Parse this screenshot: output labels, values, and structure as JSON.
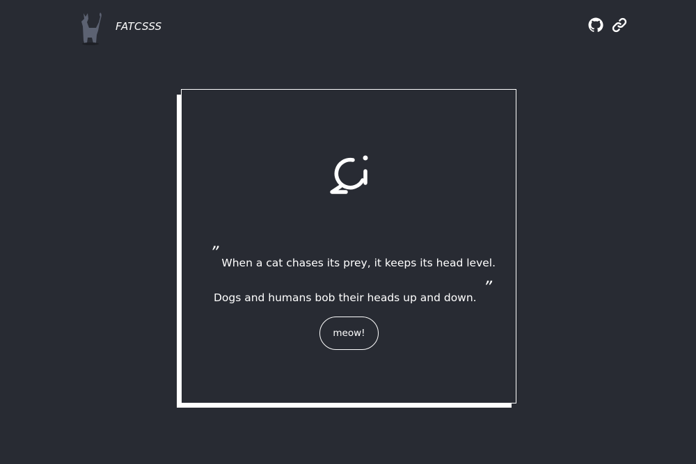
{
  "header": {
    "brand": "FATCSSS",
    "icons": [
      "cat-logo-icon",
      "github-icon",
      "link-icon"
    ]
  },
  "card": {
    "icon": "chat-info-icon",
    "quote_open": "”",
    "quote_text": "When a cat chases its prey, it keeps its head level. Dogs and humans bob their heads up and down.",
    "quote_close": "”",
    "button_label": "meow!"
  },
  "colors": {
    "background": "#282b33",
    "foreground": "#ffffff",
    "cat": "#5c6272"
  }
}
